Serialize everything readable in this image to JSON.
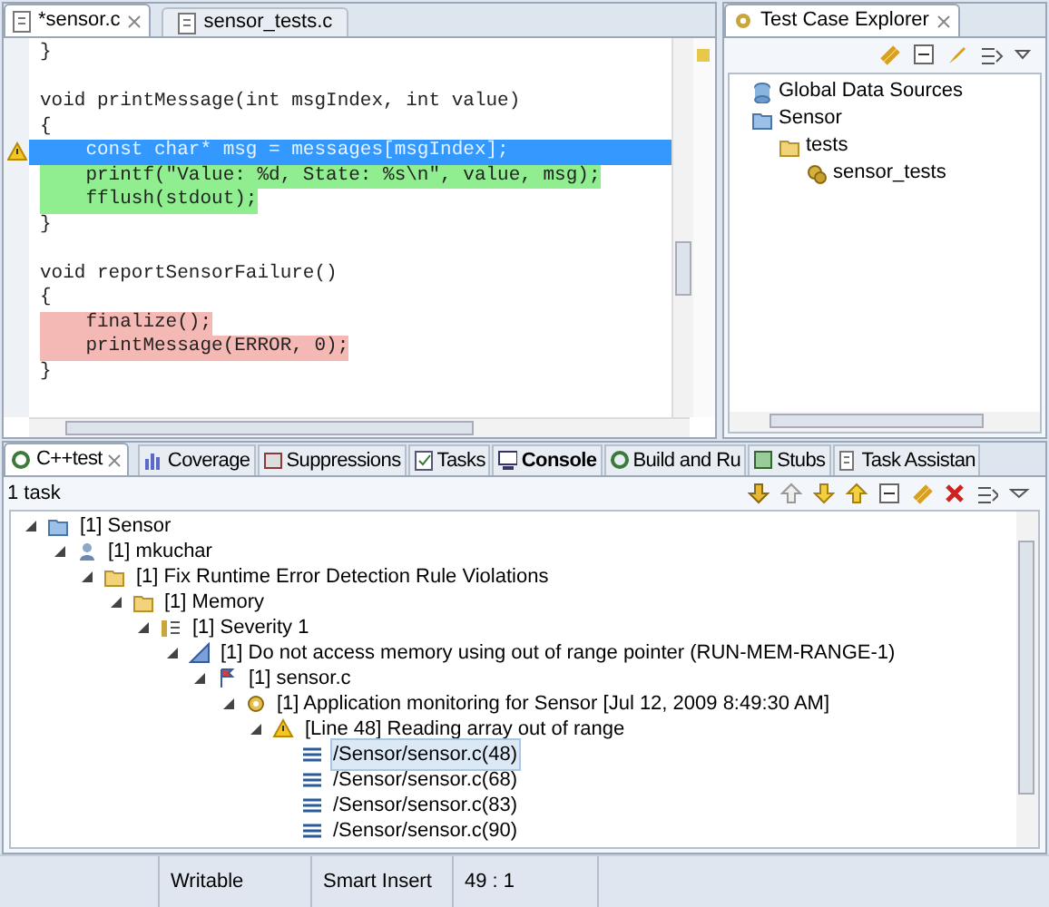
{
  "editor": {
    "tabs": [
      {
        "label": "*sensor.c",
        "selected": true
      },
      {
        "label": "sensor_tests.c",
        "selected": false
      }
    ],
    "lines": [
      {
        "text": "}"
      },
      {
        "text": "void printMessage(int msgIndex, int value)",
        "space_before": true
      },
      {
        "text": "{"
      },
      {
        "text": "    const char* msg = messages[msgIndex];",
        "selected": true,
        "warning": true
      },
      {
        "text": "    printf(\"Value: %d, State: %s\\n\", value, msg);",
        "executed": true
      },
      {
        "text": "    fflush(stdout);",
        "executed": true
      },
      {
        "text": "}"
      },
      {
        "text": "void reportSensorFailure()",
        "space_before": true
      },
      {
        "text": "{"
      },
      {
        "text": "    finalize();",
        "not_executed": true
      },
      {
        "text": "    printMessage(ERROR, 0);",
        "not_executed": true
      },
      {
        "text": "}"
      }
    ]
  },
  "explorer": {
    "title": "Test Case Explorer",
    "tree": [
      {
        "label": "Global Data Sources",
        "kind": "database"
      },
      {
        "label": "Sensor",
        "kind": "project",
        "children": [
          {
            "label": "tests",
            "kind": "folder",
            "children": [
              {
                "label": "sensor_tests",
                "kind": "tests"
              }
            ]
          }
        ]
      }
    ]
  },
  "bottom": {
    "tabs": [
      {
        "label": "C++test",
        "selected": true,
        "bold": false
      },
      {
        "label": "Coverage",
        "selected": false,
        "bold": false
      },
      {
        "label": "Suppressions",
        "selected": false,
        "bold": false
      },
      {
        "label": "Tasks",
        "selected": false,
        "bold": false
      },
      {
        "label": "Console",
        "selected": false,
        "bold": true
      },
      {
        "label": "Build and Ru",
        "selected": false,
        "bold": false
      },
      {
        "label": "Stubs",
        "selected": false,
        "bold": false
      },
      {
        "label": "Task Assistan",
        "selected": false,
        "bold": false
      }
    ],
    "summary": "1 task",
    "tree": [
      {
        "label": "[1] Sensor",
        "kind": "project",
        "expanded": true,
        "selected": false,
        "children": [
          {
            "label": "[1] mkuchar",
            "kind": "user",
            "expanded": true,
            "selected": false,
            "children": [
              {
                "label": "[1] Fix Runtime Error Detection Rule Violations",
                "kind": "folder",
                "expanded": true,
                "selected": false,
                "children": [
                  {
                    "label": "[1] Memory",
                    "kind": "folder",
                    "expanded": true,
                    "selected": false,
                    "children": [
                      {
                        "label": "[1] Severity 1",
                        "kind": "severity",
                        "expanded": true,
                        "selected": false,
                        "children": [
                          {
                            "label": "[1] Do not access memory using out of range pointer (RUN-MEM-RANGE-1)",
                            "kind": "rule",
                            "expanded": true,
                            "selected": false,
                            "children": [
                              {
                                "label": "[1] sensor.c",
                                "kind": "file",
                                "expanded": true,
                                "selected": false,
                                "children": [
                                  {
                                    "label": "[1] Application monitoring for Sensor [Jul 12, 2009 8:49:30 AM]",
                                    "kind": "run",
                                    "expanded": true,
                                    "selected": false,
                                    "children": [
                                      {
                                        "label": "[Line 48] Reading array out of range",
                                        "kind": "warning",
                                        "expanded": true,
                                        "selected": false,
                                        "children": [
                                          {
                                            "label": "/Sensor/sensor.c(48)",
                                            "kind": "location",
                                            "selected": true
                                          },
                                          {
                                            "label": "/Sensor/sensor.c(68)",
                                            "kind": "location",
                                            "selected": false
                                          },
                                          {
                                            "label": "/Sensor/sensor.c(83)",
                                            "kind": "location",
                                            "selected": false
                                          },
                                          {
                                            "label": "/Sensor/sensor.c(90)",
                                            "kind": "location",
                                            "selected": false
                                          }
                                        ]
                                      }
                                    ]
                                  }
                                ]
                              }
                            ]
                          }
                        ]
                      }
                    ]
                  }
                ]
              }
            ]
          }
        ]
      }
    ]
  },
  "status_bar": [
    "Writable",
    "Smart Insert",
    "49 : 1"
  ]
}
